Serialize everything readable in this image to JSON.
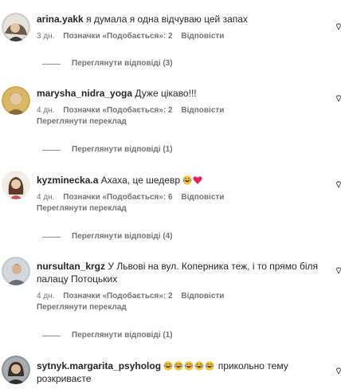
{
  "comments": [
    {
      "username": "arina.yakk",
      "text": "я думала я одна відчуваю цей запах",
      "time": "3 дн.",
      "likes": "Позначки «Подобається»: 2",
      "reply": "Відповісти",
      "translate": "",
      "view_replies": "Переглянути відповіді (3)"
    },
    {
      "username": "marysha_nidra_yoga",
      "text": "Дуже цікаво!!!",
      "time": "4 дн.",
      "likes": "Позначки «Подобається»: 2",
      "reply": "Відповісти",
      "translate": "Переглянути переклад",
      "view_replies": "Переглянути відповіді (1)"
    },
    {
      "username": "kyzminecka.a",
      "text": "Ахаха, це шедевр",
      "emojis": [
        "laugh",
        "heart"
      ],
      "time": "4 дн.",
      "likes": "Позначки «Подобається»: 6",
      "reply": "Відповісти",
      "translate": "Переглянути переклад",
      "view_replies": "Переглянути відповіді (4)"
    },
    {
      "username": "nursultan_krgz",
      "text": "У Львові на вул. Коперника теж, і то прямо біля палацу Потоцьких",
      "time": "4 дн.",
      "likes": "Позначки «Подобається»: 2",
      "reply": "Відповісти",
      "translate": "Переглянути переклад",
      "view_replies": "Переглянути відповіді (1)"
    },
    {
      "username": "sytnyk.margarita_psyholog",
      "emojis_before": [
        "laugh",
        "laugh",
        "laugh",
        "laugh",
        "laugh"
      ],
      "text": "прикольно тему розкриваєте",
      "time": "",
      "likes": "",
      "reply": "",
      "translate": "",
      "view_replies": ""
    }
  ],
  "colors": {
    "text": "#262626",
    "secondary": "#737373",
    "heart_emoji": "#e0245e",
    "laugh_emoji": "#f5c33b"
  },
  "icons": {
    "like": "heart-outline-icon",
    "emoji_laugh": "tears-of-joy-emoji",
    "emoji_heart": "red-heart-emoji"
  }
}
